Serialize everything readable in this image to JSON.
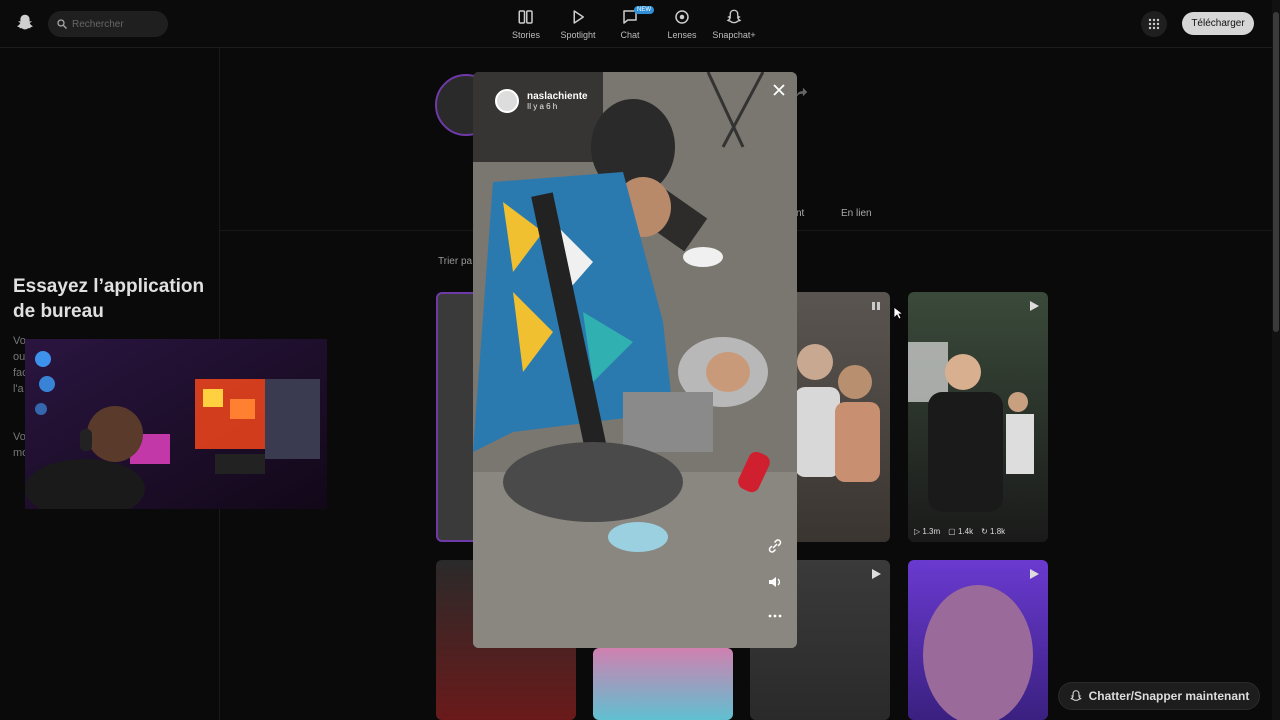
{
  "header": {
    "search_placeholder": "Rechercher",
    "nav": [
      {
        "label": "Stories",
        "icon": "stories-icon"
      },
      {
        "label": "Spotlight",
        "icon": "play-icon"
      },
      {
        "label": "Chat",
        "icon": "chat-icon",
        "badge": "NEW"
      },
      {
        "label": "Lenses",
        "icon": "lens-icon"
      },
      {
        "label": "Snapchat+",
        "icon": "ghost-plus-icon"
      }
    ],
    "download_label": "Télécharger"
  },
  "sidebar": {
    "promo_title": "Essayez l’application de bureau",
    "promo_text_lines": [
      "Vo",
      "ou",
      "fac",
      "l'a",
      "",
      "",
      "Vo",
      "mo"
    ]
  },
  "profile": {
    "tabs_partial": "nt",
    "tab_linked": "En lien",
    "sort_label": "Trier pa"
  },
  "grid": {
    "tile_stats": {
      "views": "1.3m",
      "comments": "1.4k",
      "shares": "1.8k"
    }
  },
  "modal": {
    "username": "naslachiente",
    "timestamp": "Il y a 6 h"
  },
  "chat_button": "Chatter/Snapper maintenant",
  "colors": {
    "accent_purple": "#6e3aa8",
    "badge_blue": "#2f8fd8",
    "download_bg": "#d6d6d6"
  }
}
